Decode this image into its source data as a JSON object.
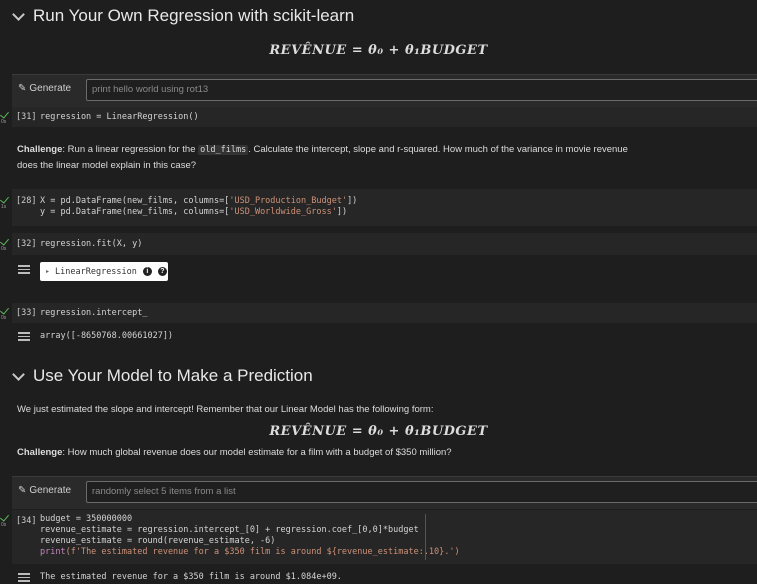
{
  "section1": {
    "heading": "Run Your Own Regression with scikit-learn",
    "formula": "REVÊNUE = θ₀ + θ₁BUDGET"
  },
  "generate1": {
    "button_label": "Generate",
    "placeholder": "print hello world using rot13"
  },
  "cell31": {
    "count": "[31]",
    "code": "regression = LinearRegression()"
  },
  "challenge1": {
    "label": "Challenge",
    "text_before": ": Run a linear regression for the ",
    "code": "old_films",
    "text_after_line1": ". Calculate the intercept, slope and r-squared. How much of the variance in movie revenue",
    "text_line2": "does the linear model explain in this case?"
  },
  "cell28": {
    "count": "[28]",
    "line1_pre": "X = pd.DataFrame(new_films, columns=[",
    "line1_str": "'USD_Production_Budget'",
    "line1_post": "])",
    "line2_pre": "y = pd.DataFrame(new_films, columns=[",
    "line2_str": "'USD_Worldwide_Gross'",
    "line2_post": "])"
  },
  "cell32": {
    "count": "[32]",
    "code": "regression.fit(X, y)",
    "widget_label": "LinearRegression",
    "info_glyph": "i",
    "help_glyph": "?"
  },
  "cell33": {
    "count": "[33]",
    "code": "regression.intercept_",
    "output": "array([-8650768.00661027])"
  },
  "section2": {
    "heading": "Use Your Model to Make a Prediction",
    "intro": "We just estimated the slope and intercept! Remember that our Linear Model has the following form:",
    "formula": "REVÊNUE = θ₀ + θ₁BUDGET",
    "challenge_label": "Challenge",
    "challenge_text": ": How much global revenue does our model estimate for a film with a budget of $350 million?"
  },
  "generate2": {
    "button_label": "Generate",
    "placeholder": "randomly select 5 items from a list"
  },
  "cell34": {
    "count": "[34]",
    "line1": "budget = 350000000",
    "line2": "revenue_estimate = regression.intercept_[0] + regression.coef_[0,0]*budget",
    "line3": "revenue_estimate = round(revenue_estimate, -6)",
    "line4_kw": "print",
    "line4_str": "(f'The estimated revenue for a $350 film is around ${revenue_estimate:.10}.')",
    "output": "The estimated revenue for a $350 film is around $1.084e+09."
  },
  "colors": {
    "background": "#1e1e1e",
    "cell": "#262626",
    "string": "#ce9178",
    "check": "#5cb85c"
  }
}
